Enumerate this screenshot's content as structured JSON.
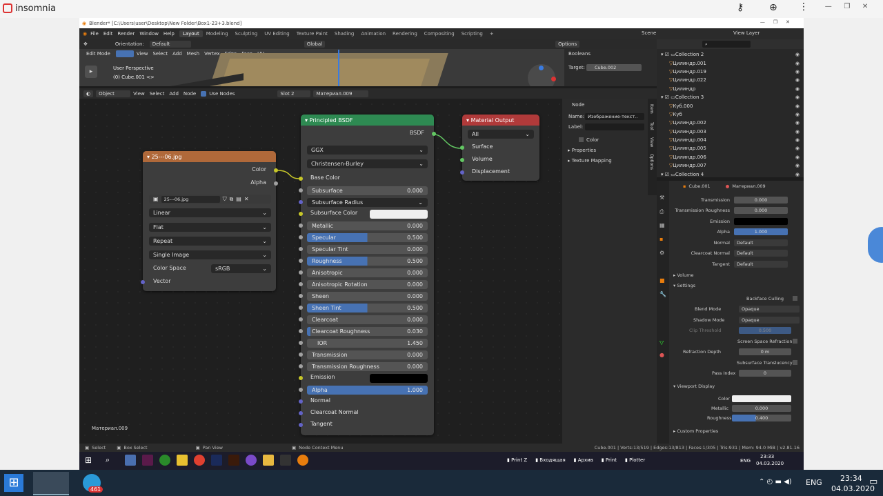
{
  "outer": {
    "app": "insomnia",
    "taskbar_lang": "ENG",
    "time": "23:34",
    "date": "04.03.2020",
    "tg_badge": "461"
  },
  "blender": {
    "title": "Blender* [C:\\Users\\user\\Desktop\\New Folder\\Box1-23+3.blend]",
    "menu": [
      "File",
      "Edit",
      "Render",
      "Window",
      "Help"
    ],
    "workspaces": [
      "Layout",
      "Modeling",
      "Sculpting",
      "UV Editing",
      "Texture Paint",
      "Shading",
      "Animation",
      "Rendering",
      "Compositing",
      "Scripting"
    ],
    "scene": "Scene",
    "view_layer": "View Layer",
    "view3d": {
      "orientation_label": "Orientation:",
      "orientation": "Default",
      "mode": "Edit Mode",
      "menus": [
        "View",
        "Select",
        "Add",
        "Mesh",
        "Vertex",
        "Edge",
        "Face",
        "UV"
      ],
      "transform": "Global",
      "options": "Options",
      "overlay1": "User Perspective",
      "overlay2": "(0) Cube.001 <>",
      "panel_booleans": "Booleans",
      "target_label": "Target:",
      "target": "Cube.002"
    },
    "node_header": {
      "type": "Object",
      "menus": [
        "View",
        "Select",
        "Add",
        "Node"
      ],
      "use_nodes": "Use Nodes",
      "slot": "Slot 2",
      "material": "Материал.009"
    },
    "image_node": {
      "title": "25---06.jpg",
      "out_color": "Color",
      "out_alpha": "Alpha",
      "image": "25---06.jpg",
      "interp": "Linear",
      "proj": "Flat",
      "ext": "Repeat",
      "source": "Single Image",
      "cs_label": "Color Space",
      "cs": "sRGB",
      "vector": "Vector"
    },
    "bsdf": {
      "title": "Principled BSDF",
      "out": "BSDF",
      "distribution": "GGX",
      "sss_method": "Christensen-Burley",
      "base_color": "Base Color",
      "fields": [
        {
          "label": "Subsurface",
          "value": "0.000",
          "fill": 0
        },
        {
          "label": "Subsurface Radius",
          "value": "",
          "fill": 0,
          "dropdown": true
        },
        {
          "label": "Subsurface Color",
          "value": "",
          "fill": 0,
          "color": "#eeeeee"
        },
        {
          "label": "Metallic",
          "value": "0.000",
          "fill": 0
        },
        {
          "label": "Specular",
          "value": "0.500",
          "fill": 50
        },
        {
          "label": "Specular Tint",
          "value": "0.000",
          "fill": 0
        },
        {
          "label": "Roughness",
          "value": "0.500",
          "fill": 50
        },
        {
          "label": "Anisotropic",
          "value": "0.000",
          "fill": 0
        },
        {
          "label": "Anisotropic Rotation",
          "value": "0.000",
          "fill": 0
        },
        {
          "label": "Sheen",
          "value": "0.000",
          "fill": 0
        },
        {
          "label": "Sheen Tint",
          "value": "0.500",
          "fill": 50
        },
        {
          "label": "Clearcoat",
          "value": "0.000",
          "fill": 0
        },
        {
          "label": "Clearcoat Roughness",
          "value": "0.030",
          "fill": 3
        },
        {
          "label": "IOR",
          "value": "1.450",
          "fill": 0
        },
        {
          "label": "Transmission",
          "value": "0.000",
          "fill": 0
        },
        {
          "label": "Transmission Roughness",
          "value": "0.000",
          "fill": 0
        },
        {
          "label": "Emission",
          "value": "",
          "fill": 0,
          "color": "#000000"
        },
        {
          "label": "Alpha",
          "value": "1.000",
          "fill": 100
        }
      ],
      "inputs_tail": [
        "Normal",
        "Clearcoat Normal",
        "Tangent"
      ]
    },
    "matout": {
      "title": "Material Output",
      "target": "All",
      "inputs": [
        "Surface",
        "Volume",
        "Displacement"
      ]
    },
    "npanel": {
      "section": "Node",
      "name_label": "Name:",
      "name": "Изображение-текст..",
      "label_label": "Label:",
      "color": "Color",
      "props": "Properties",
      "tex_map": "Texture Mapping",
      "tabs": [
        "Item",
        "Tool",
        "View",
        "Options"
      ]
    },
    "node_footer": "Материал.009",
    "outliner": [
      {
        "name": "Collection 2",
        "indent": 0,
        "coll": true
      },
      {
        "name": "Цилиндр.001",
        "indent": 1
      },
      {
        "name": "Цилиндр.019",
        "indent": 1
      },
      {
        "name": "Цилиндр.022",
        "indent": 1
      },
      {
        "name": "Цилиндр",
        "indent": 1
      },
      {
        "name": "Collection 3",
        "indent": 0,
        "coll": true
      },
      {
        "name": "Куб.000",
        "indent": 1
      },
      {
        "name": "Куб",
        "indent": 1
      },
      {
        "name": "Цилиндр.002",
        "indent": 1
      },
      {
        "name": "Цилиндр.003",
        "indent": 1
      },
      {
        "name": "Цилиндр.004",
        "indent": 1
      },
      {
        "name": "Цилиндр.005",
        "indent": 1
      },
      {
        "name": "Цилиндр.006",
        "indent": 1
      },
      {
        "name": "Цилиндр.007",
        "indent": 1
      },
      {
        "name": "Collection 4",
        "indent": 0,
        "coll": true
      }
    ],
    "props": {
      "object": "Cube.001",
      "material": "Материал.009",
      "rows": [
        {
          "label": "Transmission",
          "value": "0.000"
        },
        {
          "label": "Transmission Roughness",
          "value": "0.000"
        },
        {
          "label": "Emission",
          "value": "",
          "color": "#000000"
        },
        {
          "label": "Alpha",
          "value": "1.000",
          "blue": true
        },
        {
          "label": "Normal",
          "value": "Default"
        },
        {
          "label": "Clearcoat Normal",
          "value": "Default"
        },
        {
          "label": "Tangent",
          "value": "Default"
        }
      ],
      "volume": "Volume",
      "settings": "Settings",
      "backface": "Backface Culling",
      "blend_label": "Blend Mode",
      "blend": "Opaque",
      "shadow_label": "Shadow Mode",
      "shadow": "Opaque",
      "clip_label": "Clip Threshold",
      "clip": "0.500",
      "ssr": "Screen Space Refraction",
      "refr_label": "Refraction Depth",
      "refr": "0 m",
      "sst": "Subsurface Translucency",
      "pass_label": "Pass Index",
      "pass": "0",
      "vp_display": "Viewport Display",
      "vp_color": "Color",
      "vp_metal_label": "Metallic",
      "vp_metal": "0.000",
      "vp_rough_label": "Roughness",
      "vp_rough": "0.400",
      "custom": "Custom Properties"
    },
    "status": {
      "select": "Select",
      "box": "Box Select",
      "pan": "Pan View",
      "ctx": "Node Context Menu",
      "stats": "Cube.001 | Verts:13/519 | Edges:13/813 | Faces:1/305 | Tris:931 | Mem: 94.0 MiB | v2.81.16"
    },
    "inner_taskbar": {
      "items": [
        "Print Z",
        "Входящая",
        "Архив",
        "Print",
        "Plotter"
      ],
      "lang": "ENG",
      "time": "23:33",
      "date": "04.03.2020"
    }
  }
}
